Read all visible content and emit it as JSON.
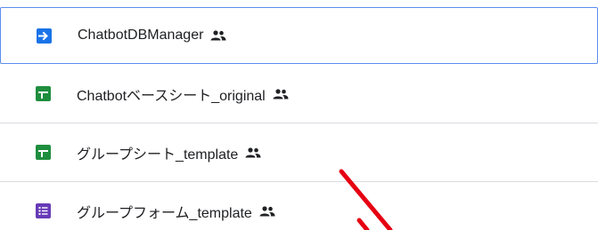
{
  "files": [
    {
      "name": "ChatbotDBManager",
      "icon": "apps-script-icon",
      "icon_color": "#1a73e8",
      "shared": true,
      "selected": true
    },
    {
      "name": "Chatbotベースシート_original",
      "icon": "sheets-icon",
      "icon_color": "#1e8e3e",
      "shared": true,
      "selected": false
    },
    {
      "name": "グループシート_template",
      "icon": "sheets-icon",
      "icon_color": "#1e8e3e",
      "shared": true,
      "selected": false
    },
    {
      "name": "グループフォーム_template",
      "icon": "forms-icon",
      "icon_color": "#673ab7",
      "shared": true,
      "selected": false
    }
  ],
  "annotation": {
    "color": "#e60012"
  }
}
